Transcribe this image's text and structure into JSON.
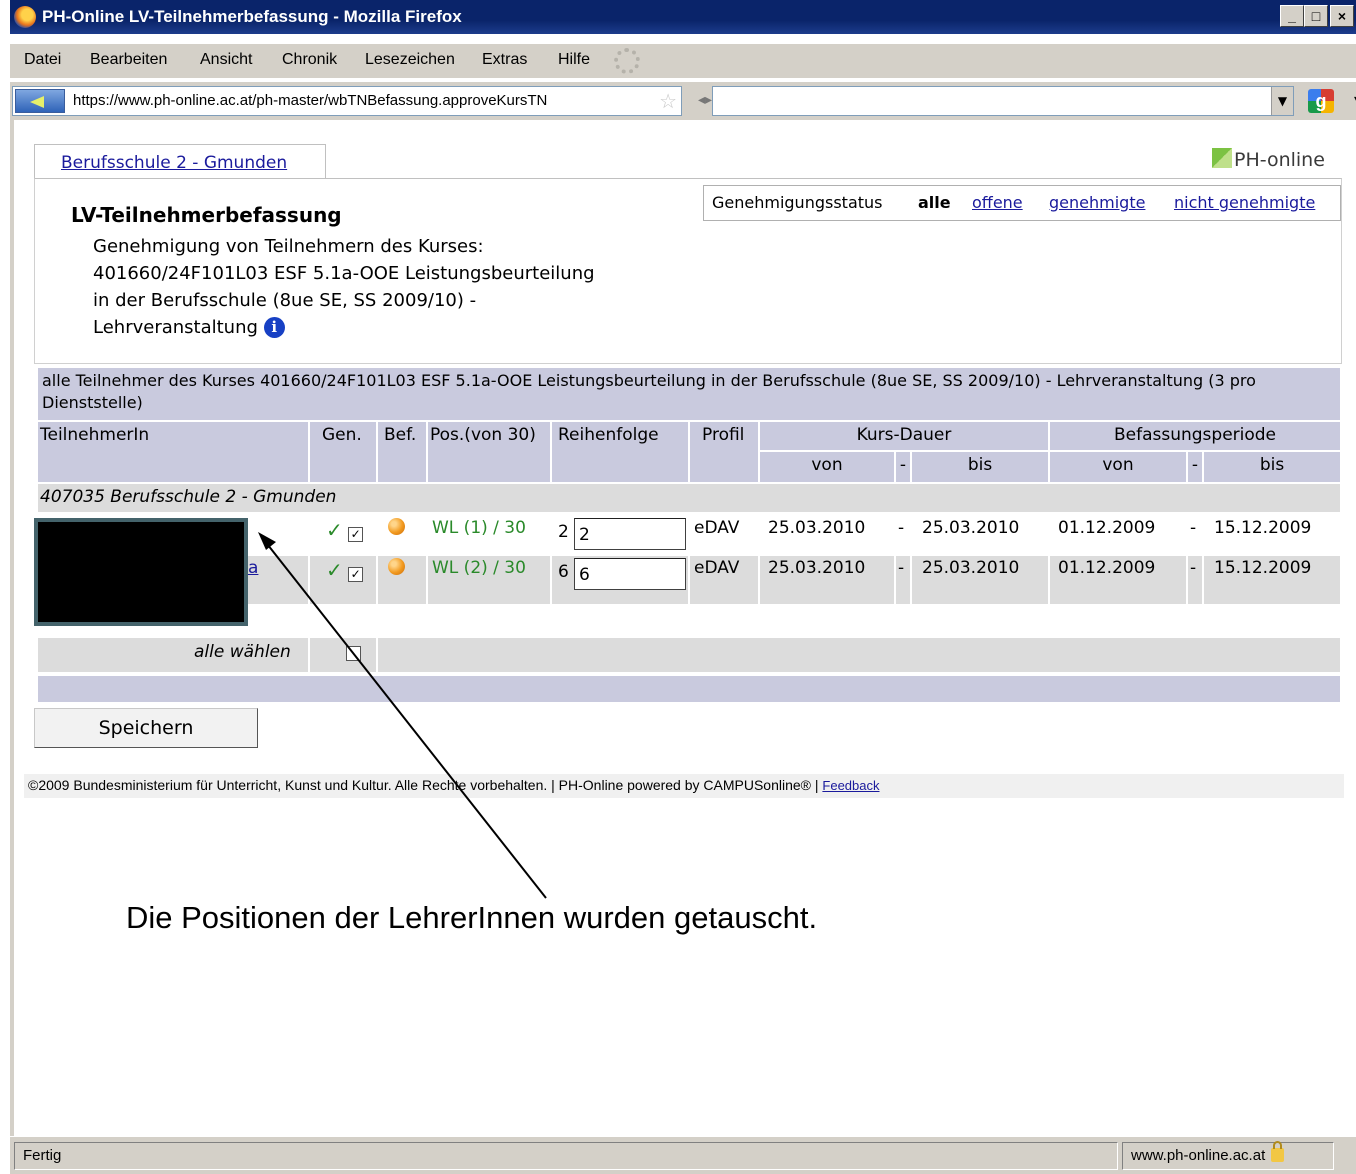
{
  "window": {
    "title": "PH-Online LV-Teilnehmerbefassung - Mozilla Firefox",
    "controls": [
      "_",
      "□",
      "×"
    ]
  },
  "menu": [
    "Datei",
    "Bearbeiten",
    "Ansicht",
    "Chronik",
    "Lesezeichen",
    "Extras",
    "Hilfe"
  ],
  "nav": {
    "url": "https://www.ph-online.ac.at/ph-master/wbTNBefassung.approveKursTN",
    "search_value": ""
  },
  "tab": {
    "label": "Berufsschule 2 - Gmunden"
  },
  "logo": {
    "text": "PH-online"
  },
  "status_filter": {
    "label": "Genehmigungsstatus",
    "current": "alle",
    "options": [
      "offene",
      "genehmigte",
      "nicht genehmigte"
    ]
  },
  "header": {
    "title": "LV-Teilnehmerbefassung",
    "desc_lines": [
      "Genehmigung von Teilnehmern des Kurses:",
      "401660/24F101L03 ESF 5.1a-OOE Leistungsbeurteilung",
      "in der Berufsschule (8ue SE, SS 2009/10) -",
      "Lehrveranstaltung"
    ]
  },
  "table": {
    "caption": "alle Teilnehmer des Kurses 401660/24F101L03 ESF 5.1a-OOE Leistungsbeurteilung in der Berufsschule (8ue SE, SS 2009/10) - Lehrveranstaltung (3 pro Dienststelle)",
    "headers": {
      "teilnehmer": "TeilnehmerIn",
      "gen": "Gen.",
      "bef": "Bef.",
      "pos": "Pos.(von 30)",
      "reihenfolge": "Reihenfolge",
      "profil": "Profil",
      "kurs_dauer": "Kurs-Dauer",
      "befassungsperiode": "Befassungsperiode",
      "von": "von",
      "dash": "-",
      "bis": "bis"
    },
    "group": "407035 Berufsschule 2 - Gmunden",
    "rows": [
      {
        "name": "",
        "gen_checked": true,
        "bef_checked": true,
        "pos": "WL (1) / 30",
        "order_label": "2",
        "order_value": "2",
        "profil": "eDAV",
        "kurs_von": "25.03.2010",
        "kurs_bis": "25.03.2010",
        "bef_von": "01.12.2009",
        "bef_bis": "15.12.2009"
      },
      {
        "name": "a",
        "gen_checked": true,
        "bef_checked": true,
        "pos": "WL (2) / 30",
        "order_label": "6",
        "order_value": "6",
        "profil": "eDAV",
        "kurs_von": "25.03.2010",
        "kurs_bis": "25.03.2010",
        "bef_von": "01.12.2009",
        "bef_bis": "15.12.2009"
      }
    ],
    "select_all_label": "alle wählen",
    "select_all_checked": false
  },
  "save_button": "Speichern",
  "footer": {
    "text": "©2009 Bundesministerium für Unterricht, Kunst und Kultur. Alle Rechte vorbehalten. | PH-Online powered by CAMPUSonline® |",
    "feedback": "Feedback"
  },
  "annotation": "Die Positionen der LehrerInnen wurden getauscht.",
  "statusbar": {
    "left": "Fertig",
    "right": "www.ph-online.ac.at"
  },
  "icons": {
    "check": "✓",
    "checkbox_checked": "☑",
    "star": "☆"
  }
}
